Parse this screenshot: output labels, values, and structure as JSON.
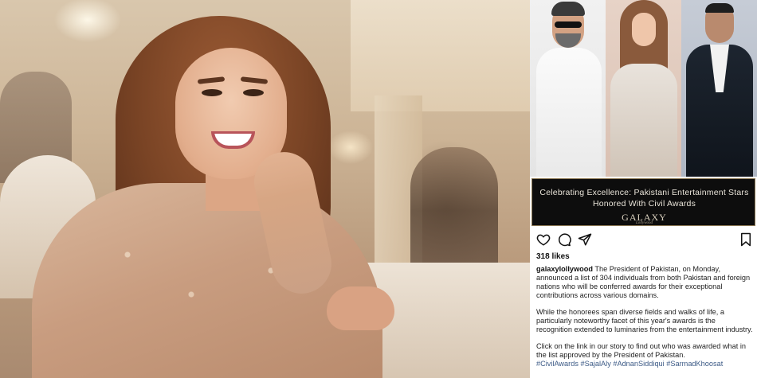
{
  "left_photo": {},
  "post": {
    "image_banner": {
      "title_line1": "Celebrating Excellence: Pakistani Entertainment Stars",
      "title_line2": "Honored With Civil Awards",
      "logo": "GALAXY",
      "logo_sub": "Lollywood"
    },
    "actions": {
      "like_icon": "heart-icon",
      "comment_icon": "comment-icon",
      "share_icon": "share-icon",
      "save_icon": "bookmark-icon"
    },
    "likes": "318 likes",
    "username": "galaxylollywood",
    "caption_p1": " The President of Pakistan, on Monday, announced a list of 304 individuals from both Pakistan and foreign nations who will be conferred awards for their exceptional contributions across various domains.",
    "caption_p2": "While the honorees span diverse fields and walks of life, a particularly noteworthy facet of this year's awards is the recognition extended to luminaries from the entertainment industry.",
    "caption_p3": "Click on the link in our story to find out who was awarded what in the list approved by the President of Pakistan.",
    "hashtags": "#CivilAwards #SajalAly #AdnanSiddiqui #SarmadKhoosat"
  }
}
